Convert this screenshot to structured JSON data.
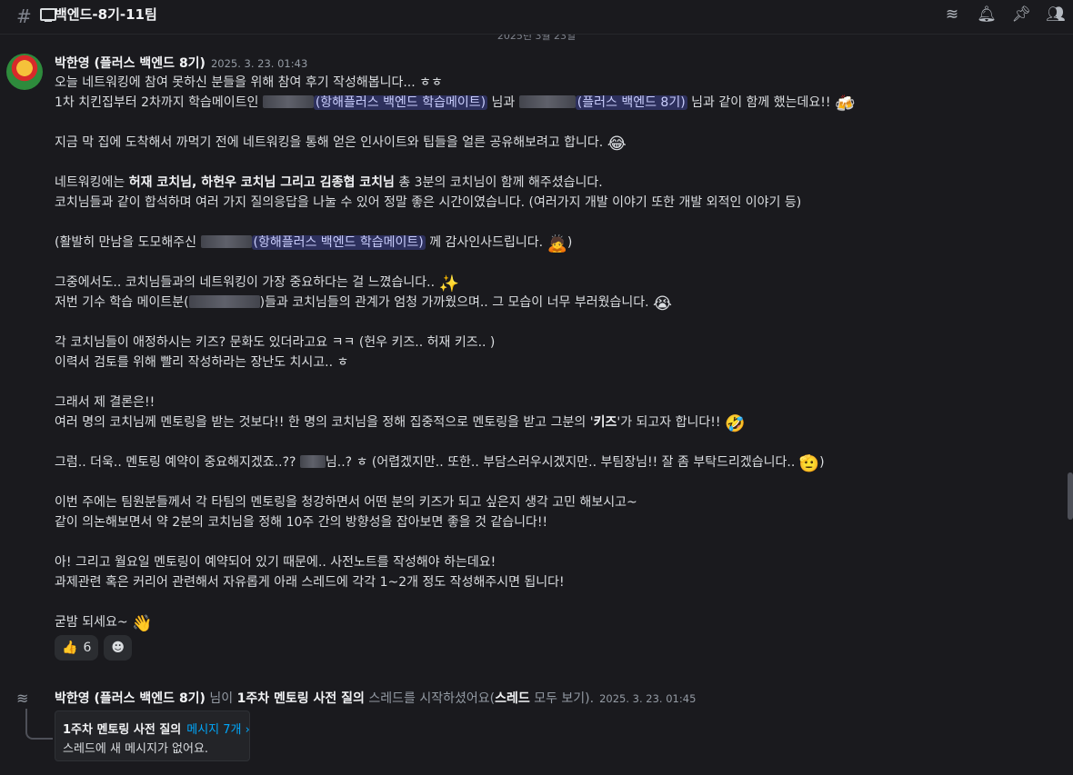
{
  "header": {
    "channel_name": "백엔드-8기-11팀"
  },
  "date_divider": "2025년 3월 23일",
  "message": {
    "author": "박한영 (플러스 백엔드 8기)",
    "timestamp": "2025. 3. 23. 01:43",
    "mention_mate": "(항해플러스 백엔드 학습메이트)",
    "mention_8th": "(플러스 백엔드 8기)",
    "lines": {
      "l1": "오늘 네트워킹에 참여 못하신 분들을 위해 참여 후기 작성해봅니다... ㅎㅎ",
      "l2a": "1차 치킨집부터 2차까지 학습메이트인 ",
      "l2b": " 님과 ",
      "l2c": " 님과 같이 함께 했는데요!! ",
      "l3": "지금 막 집에 도착해서 까먹기 전에 네트워킹을 통해 얻은 인사이트와 팁들을 얼른 공유해보려고 합니다. ",
      "l4a": "네트워킹에는 ",
      "l4b": "허재 코치님, 하헌우 코치님 그리고 김종협 코치님",
      "l4c": " 총 3분의 코치님이 함께 해주셨습니다.",
      "l5": "코치님들과 같이 합석하며 여러 가지 질의응답을 나눌 수 있어 정말 좋은 시간이였습니다. (여러가지 개발 이야기 또한 개발 외적인 이야기 등)",
      "l6a": "(활발히 만남을 도모해주신 ",
      "l6b": " 께 감사인사드립니다. ",
      "l6c": ")",
      "l7": "그중에서도.. 코치님들과의 네트워킹이 가장 중요하다는 걸 느꼈습니다.. ",
      "l8a": "저번 기수 학습 메이트분(",
      "l8b": ")들과 코치님들의 관계가 엄청 가까웠으며.. 그 모습이 너무 부러웠습니다. ",
      "l9": "각 코치님들이 애정하시는 키즈? 문화도 있더라고요 ㅋㅋ (헌우 키즈.. 허재 키즈.. )",
      "l10": "이력서 검토를 위해 빨리 작성하라는 장난도 치시고.. ㅎ",
      "l11": "그래서 제 결론은!!",
      "l12a": "여러 명의 코치님께 멘토링을 받는 것보다!! 한 명의 코치님을 정해 집중적으로 멘토링을 받고 그분의 '",
      "l12b": "키즈",
      "l12c": "'가 되고자 합니다!! ",
      "l13a": "그럼.. 더욱.. 멘토링 예약이 중요해지겠죠..?? ",
      "l13b": "님..? ㅎ (어렵겠지만.. 또한.. 부담스러우시겠지만.. 부팀장님!! 잘 좀 부탁드리겠습니다.. ",
      "l13c": ")",
      "l14": "이번 주에는 팀원분들께서 각 타팀의 멘토링을 청강하면서 어떤 분의 키즈가 되고 싶은지 생각 고민 해보시고~",
      "l15": "같이 의논해보면서 약 2분의 코치님을 정해 10주 간의 방향성을 잡아보면 좋을 것 같습니다!!",
      "l16": "아! 그리고 월요일 멘토링이 예약되어 있기 때문에.. 사전노트를 작성해야 하는데요!",
      "l17": "과제관련 혹은 커리어 관련해서 자유롭게 아래 스레드에 각각 1~2개 정도 작성해주시면 됩니다!",
      "l18": "굳밤 되세요~ "
    },
    "emojis": {
      "beer": "🍻",
      "joy": "😂",
      "bow": "🙇",
      "sparkles": "✨",
      "cry": "😭",
      "rofl": "🤣",
      "salute": "🫡",
      "wave": "👋"
    },
    "reactions": [
      {
        "emoji": "👍",
        "count": "6"
      },
      {
        "emoji": "☻",
        "count": ""
      }
    ]
  },
  "thread": {
    "author": "박한영 (플러스 백엔드 8기)",
    "text_a": " 님이 ",
    "thread_name": "1주차 멘토링 사전 질의",
    "text_b": " 스레드를 시작하셨어요(",
    "thread_word": "스레드",
    "text_c": " 모두 보기).",
    "timestamp": "2025. 3. 23. 01:45",
    "card_title": "1주차 멘토링 사전 질의",
    "card_count": "메시지 7개 ›",
    "card_sub": "스레드에 새 메시지가 없어요."
  }
}
